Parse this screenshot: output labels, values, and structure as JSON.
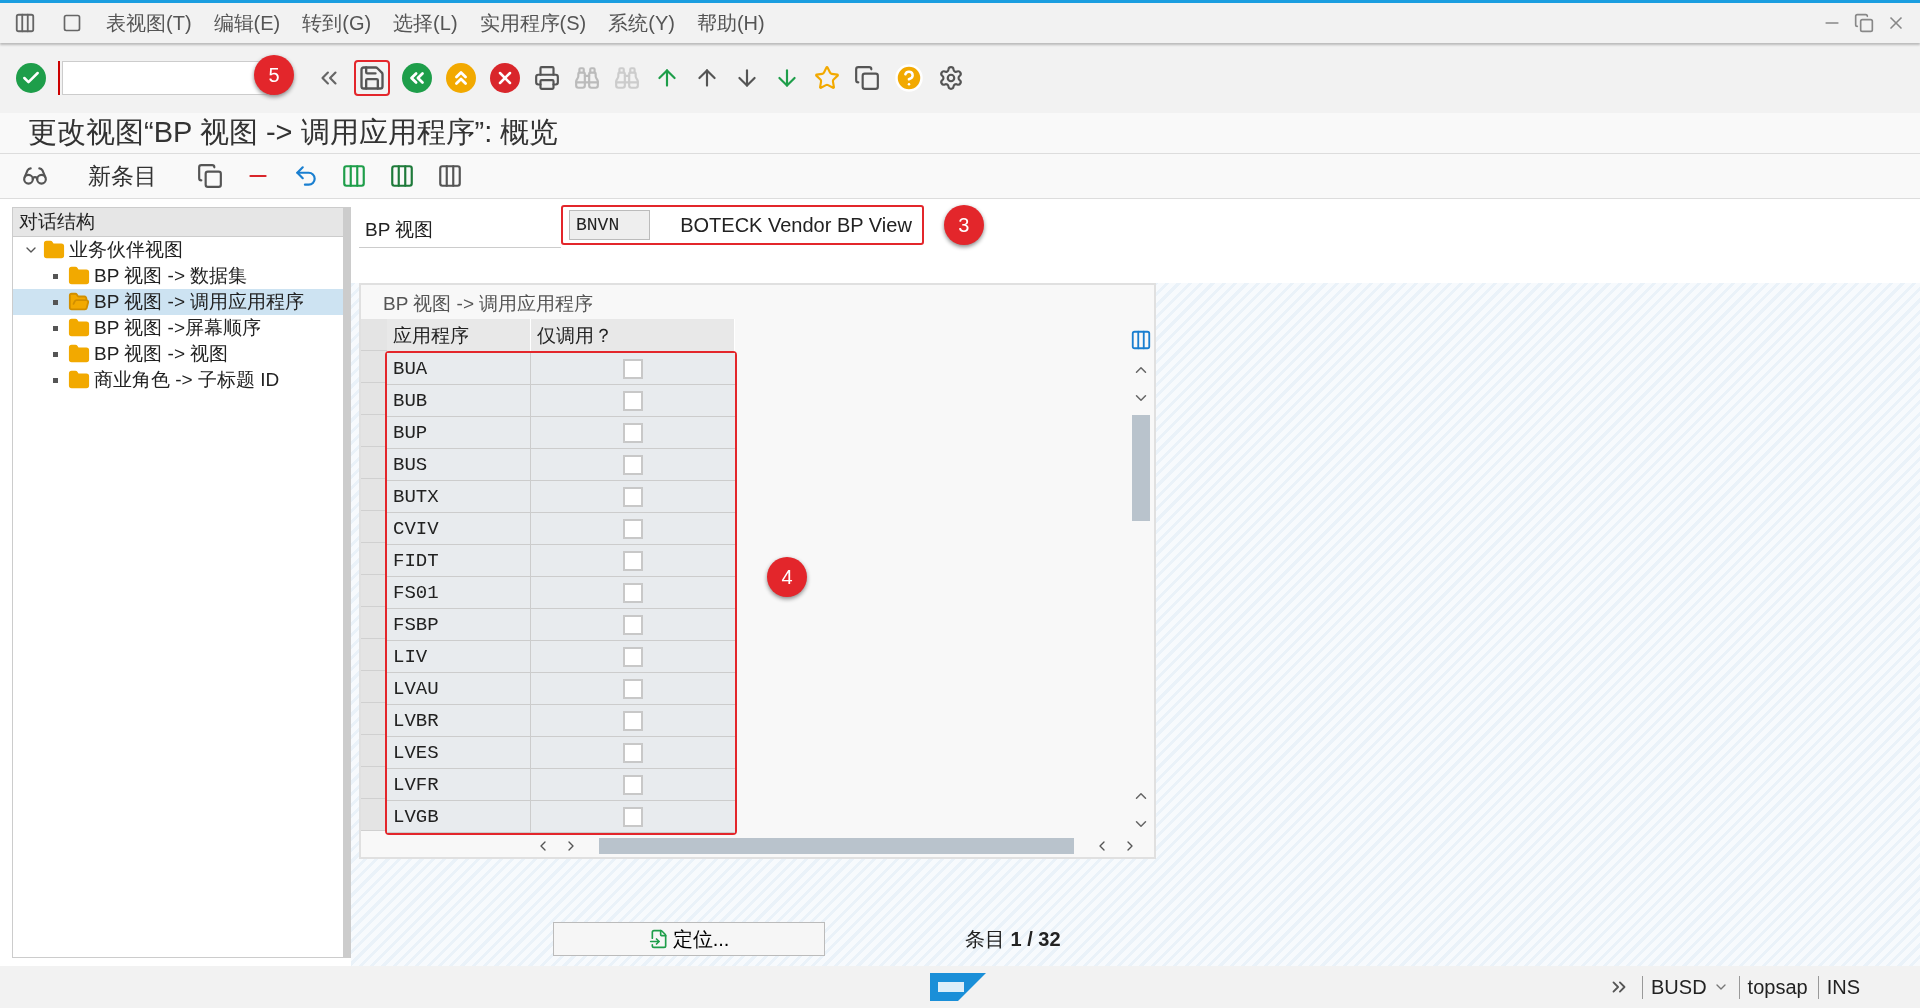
{
  "menu": [
    "表视图(T)",
    "编辑(E)",
    "转到(G)",
    "选择(L)",
    "实用程序(S)",
    "系统(Y)",
    "帮助(H)"
  ],
  "title": "更改视图“BP 视图 -> 调用应用程序”: 概览",
  "app_toolbar": {
    "new_entries": "新条目"
  },
  "dialog_structure": {
    "header": "对话结构",
    "tree": [
      {
        "label": "业务伙伴视图",
        "expanded": true,
        "selected": false,
        "children": [
          {
            "label": "BP 视图 -> 数据集",
            "selected": false
          },
          {
            "label": "BP 视图 -> 调用应用程序",
            "selected": true
          },
          {
            "label": "BP 视图 ->屏幕顺序",
            "selected": false
          },
          {
            "label": "BP 视图 -> 视图",
            "selected": false
          },
          {
            "label": "商业角色 -> 子标题 ID",
            "selected": false
          }
        ]
      }
    ]
  },
  "view_field": {
    "label": "BP 视图",
    "code": "BNVN",
    "description": "BOTECK Vendor BP View"
  },
  "table": {
    "title": "BP 视图 -> 调用应用程序",
    "columns": [
      "应用程序",
      "仅调用？"
    ],
    "rows": [
      {
        "application": "BUA",
        "checked": false
      },
      {
        "application": "BUB",
        "checked": false
      },
      {
        "application": "BUP",
        "checked": false
      },
      {
        "application": "BUS",
        "checked": false
      },
      {
        "application": "BUTX",
        "checked": false
      },
      {
        "application": "CVIV",
        "checked": false
      },
      {
        "application": "FIDT",
        "checked": false
      },
      {
        "application": "FS01",
        "checked": false
      },
      {
        "application": "FSBP",
        "checked": false
      },
      {
        "application": "LIV",
        "checked": false
      },
      {
        "application": "LVAU",
        "checked": false
      },
      {
        "application": "LVBR",
        "checked": false
      },
      {
        "application": "LVES",
        "checked": false
      },
      {
        "application": "LVFR",
        "checked": false
      },
      {
        "application": "LVGB",
        "checked": false
      }
    ]
  },
  "position_button": "定位...",
  "entry_count": {
    "label": "条目",
    "value": "1 / 32"
  },
  "status_bar": {
    "system": "BUSD",
    "user": "topsap",
    "mode": "INS"
  },
  "annotations": [
    "5",
    "3",
    "4"
  ]
}
